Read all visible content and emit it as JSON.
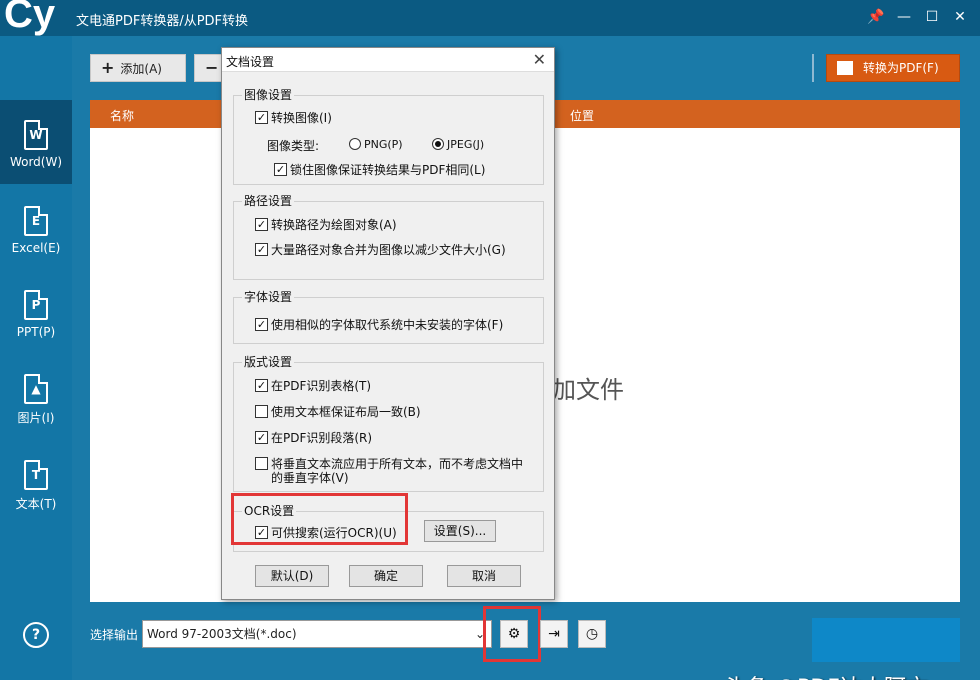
{
  "app": {
    "title": "文电通PDF转换器/从PDF转换",
    "logo_text": "Cy"
  },
  "window_controls": {
    "pin": "📌",
    "minimize": "—",
    "maximize": "☐",
    "close": "✕"
  },
  "sidebar": {
    "items": [
      {
        "letter": "W",
        "label": "Word(W)",
        "active": true
      },
      {
        "letter": "E",
        "label": "Excel(E)"
      },
      {
        "letter": "P",
        "label": "PPT(P)"
      },
      {
        "letter": "▲",
        "label": "图片(I)"
      },
      {
        "letter": "T",
        "label": "文本(T)"
      }
    ],
    "help": "?"
  },
  "toolbar": {
    "add_label": "添加(A)",
    "add_icon": "+",
    "remove_icon": "−",
    "convert_label": "转换为PDF(F)"
  },
  "file_list": {
    "col_name": "名称",
    "col_location": "位置",
    "empty_hint": "加文件"
  },
  "output": {
    "label": "选择输出",
    "format": "Word 97-2003文档(*.doc)",
    "chevron": "⌄"
  },
  "bottom_buttons": {
    "gear": "⚙",
    "export": "⇥",
    "history": "◷"
  },
  "watermark": "头条 @PDF达人阿文",
  "dialog": {
    "title": "文档设置",
    "close": "✕",
    "image_group": {
      "title": "图像设置",
      "convert_image": "转换图像(I)",
      "type_label": "图像类型:",
      "png": "PNG(P)",
      "jpeg": "JPEG(J)",
      "lock_image": "锁住图像保证转换结果与PDF相同(L)"
    },
    "path_group": {
      "title": "路径设置",
      "convert_path": "转换路径为绘图对象(A)",
      "merge_paths": "大量路径对象合并为图像以减少文件大小(G)"
    },
    "font_group": {
      "title": "字体设置",
      "similar_font": "使用相似的字体取代系统中未安装的字体(F)"
    },
    "layout_group": {
      "title": "版式设置",
      "detect_table": "在PDF识别表格(T)",
      "textbox_layout": "使用文本框保证布局一致(B)",
      "detect_paragraph": "在PDF识别段落(R)",
      "vertical_line1": "将垂直文本流应用于所有文本，而不考虑文档中",
      "vertical_line2": "的垂直字体(V)"
    },
    "ocr_group": {
      "title": "OCR设置",
      "searchable": "可供搜索(运行OCR)(U)",
      "settings_button": "设置(S)..."
    },
    "buttons": {
      "default": "默认(D)",
      "ok": "确定",
      "cancel": "取消"
    }
  }
}
